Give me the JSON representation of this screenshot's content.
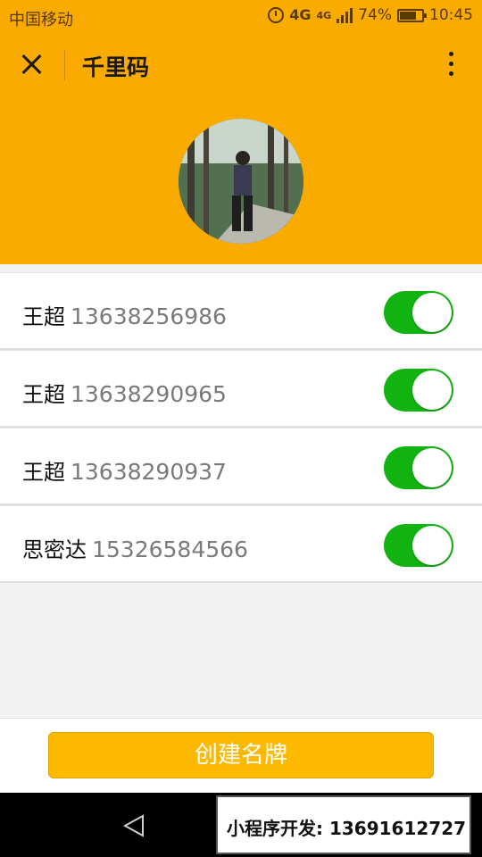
{
  "status_bar": {
    "carrier": "中国移动",
    "network": "4G",
    "network2": "4G",
    "battery": "74%",
    "time": "10:45"
  },
  "header": {
    "title": "千里码"
  },
  "contacts": [
    {
      "name": "王超",
      "phone": "13638256986",
      "enabled": true
    },
    {
      "name": "王超",
      "phone": "13638290965",
      "enabled": true
    },
    {
      "name": "王超",
      "phone": "13638290937",
      "enabled": true
    },
    {
      "name": "思密达",
      "phone": "15326584566",
      "enabled": true
    }
  ],
  "actions": {
    "create_label": "创建名牌"
  },
  "promo": {
    "text": "小程序开发: 13691612727"
  },
  "colors": {
    "accent": "#f9ab00",
    "toggle_on": "#11b311",
    "button": "#fbb900"
  }
}
